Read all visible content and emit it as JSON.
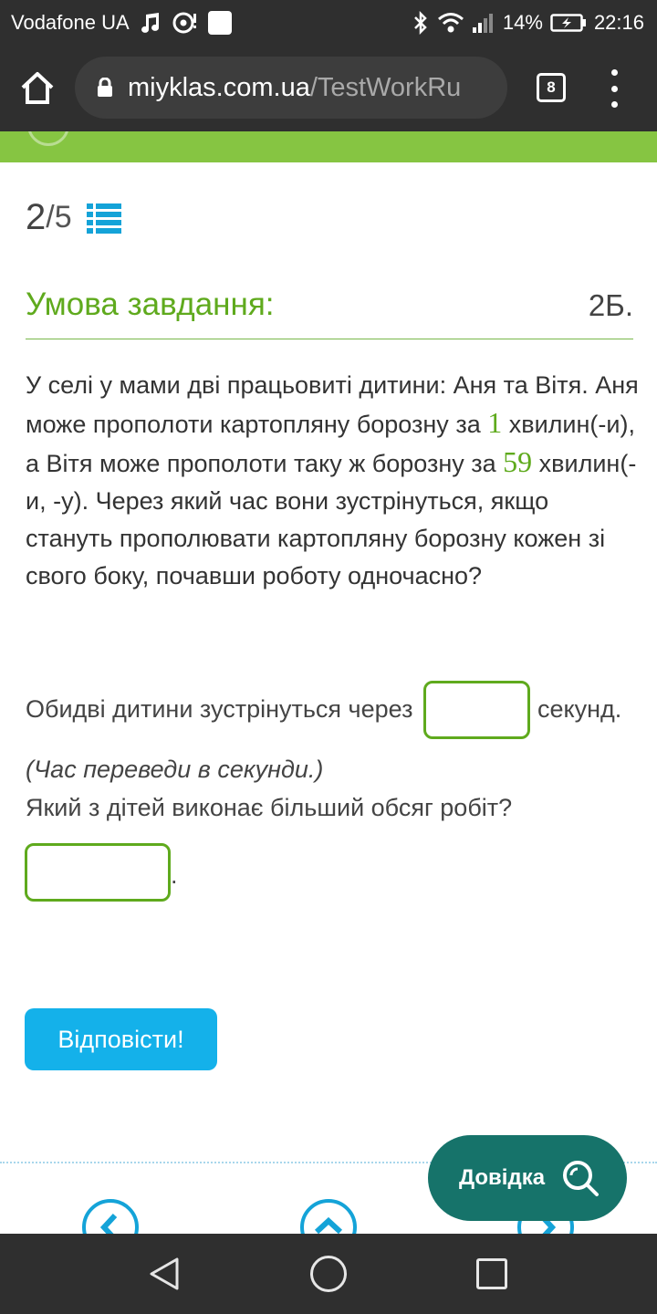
{
  "status_bar": {
    "carrier": "Vodafone UA",
    "battery": "14%",
    "time": "22:16",
    "icons": [
      "music-note-icon",
      "hotspot-icon",
      "notification-square-icon",
      "bluetooth-icon",
      "wifi-icon",
      "signal-icon",
      "battery-charging-icon"
    ]
  },
  "browser": {
    "url_domain": "miyklas.com.ua",
    "url_path": "/TestWorkRu",
    "tab_count": "8"
  },
  "progress": {
    "current": "2",
    "separator": "/",
    "total": "5"
  },
  "task": {
    "title": "Умова завдання:",
    "points": "2Б.",
    "text_1": "У селі у мами дві працьовиті дитини: Аня та Вітя. Аня може прополоти картопляну борозну за ",
    "num_1": "1",
    "text_2": " хвилин(-и), а Вітя може прополоти таку ж борозну за ",
    "num_2": "59",
    "text_3": " хвилин(-и, -у). Через який час вони зустрінуться, якщо стануть прополювати картопляну борозну кожен зі свого боку, почавши роботу одночасно?"
  },
  "answer": {
    "line1_pre": "Обидві дитини зустрінуться через",
    "line1_value": "",
    "line1_post": "секунд.",
    "hint": "(Час переведи в секунди.)",
    "question2": "Який з дітей виконає більший обсяг робіт?",
    "line2_value": "",
    "line2_suffix": "."
  },
  "buttons": {
    "submit": "Відповісти!",
    "help": "Довідка"
  },
  "colors": {
    "accent_green": "#5faa1d",
    "band_green": "#86c542",
    "button_blue": "#14b1ea",
    "help_teal": "#16736a",
    "system_bar": "#2f2f2f"
  }
}
